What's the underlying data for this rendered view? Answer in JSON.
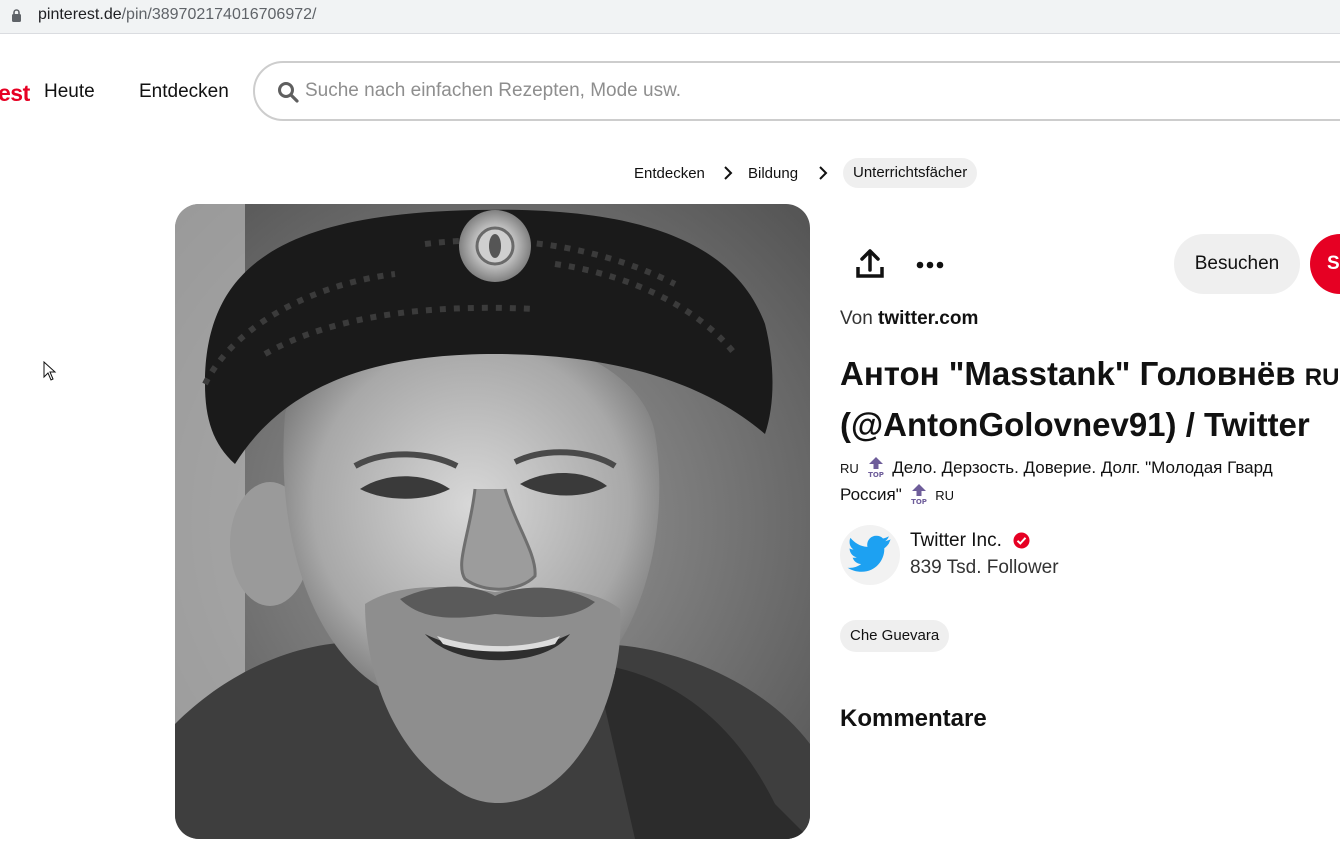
{
  "browser": {
    "url_host": "pinterest.de",
    "url_path": "/pin/389702174016706972/"
  },
  "header": {
    "logo_fragment": "est",
    "nav": [
      "Heute",
      "Entdecken"
    ],
    "search_placeholder": "Suche nach einfachen Rezepten, Mode usw."
  },
  "breadcrumbs": [
    "Entdecken",
    "Bildung",
    "Unterrichtsfächer"
  ],
  "pin": {
    "actions": {
      "visit_label": "Besuchen",
      "save_label_fragment": "S"
    },
    "source_prefix": "Von",
    "source_domain": "twitter.com",
    "title_line1": "Антон \"Masstank\" Головнёв",
    "title_line1_flag": "RU",
    "title_line2": "(@AntonGolovnev91) / Twitter",
    "description": {
      "flag_start": "RU",
      "text_line1": "Дело. Дерзость. Доверие. Долг. \"Молодая Гвард",
      "text_line2": "Россия\"",
      "flag_end": "RU"
    },
    "creator": {
      "name": "Twitter Inc.",
      "followers": "839 Tsd. Follower"
    },
    "tags": [
      "Che Guevara"
    ],
    "comments_heading": "Kommentare"
  },
  "colors": {
    "brand_red": "#e60023",
    "chip_gray": "#efefef",
    "twitter_blue": "#1da1f2",
    "verified_red": "#e60023"
  },
  "icons": [
    "lock-icon",
    "search-icon",
    "chevron-right-icon",
    "share-icon",
    "more-icon",
    "twitter-bird-icon",
    "verified-icon",
    "top-badge-icon",
    "cursor-icon"
  ]
}
